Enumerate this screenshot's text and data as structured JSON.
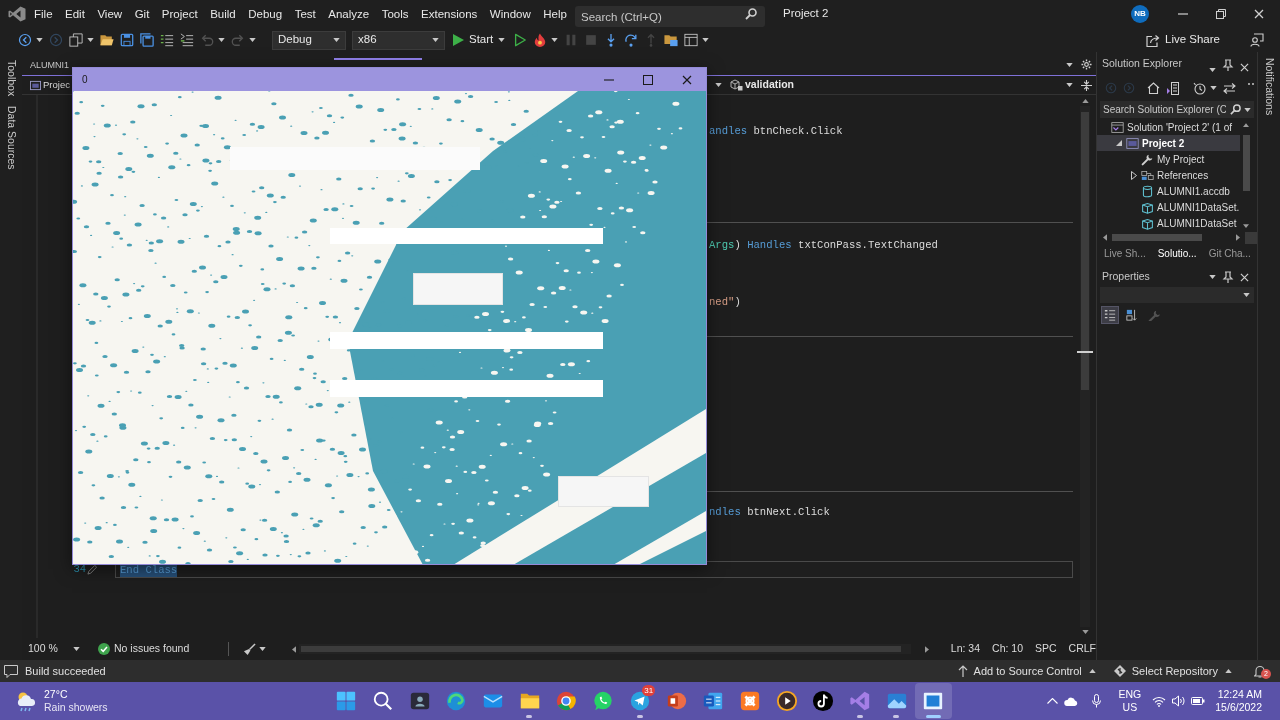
{
  "menu_bar": {
    "items": [
      "File",
      "Edit",
      "View",
      "Git",
      "Project",
      "Build",
      "Debug",
      "Test",
      "Analyze",
      "Tools",
      "Extensions",
      "Window",
      "Help"
    ],
    "search": {
      "placeholder": "Search (Ctrl+Q)"
    },
    "project_name": "Project 2",
    "account_initials": "NB"
  },
  "toolbar": {
    "left_buttons": [
      {
        "kind": "back",
        "disabled": false
      },
      {
        "kind": "forward",
        "disabled": true
      },
      {
        "kind": "new",
        "disabled": false
      },
      {
        "kind": "open",
        "disabled": false
      },
      {
        "kind": "save",
        "disabled": false
      },
      {
        "kind": "saveall",
        "disabled": false
      },
      {
        "kind": "comment",
        "disabled": false
      },
      {
        "kind": "uncomment",
        "disabled": false
      },
      {
        "kind": "undo",
        "disabled": true
      },
      {
        "kind": "redo",
        "disabled": true
      }
    ],
    "configuration": "Debug",
    "platform": "x86",
    "start_label": "Start",
    "right_buttons": [
      {
        "kind": "run",
        "disabled": false
      },
      {
        "kind": "reload",
        "disabled": false
      },
      {
        "kind": "pause",
        "disabled": true
      },
      {
        "kind": "stop",
        "disabled": true
      },
      {
        "kind": "stepinto",
        "disabled": false
      },
      {
        "kind": "stepover",
        "disabled": false
      },
      {
        "kind": "stepout",
        "disabled": true
      },
      {
        "kind": "browse",
        "disabled": false
      },
      {
        "kind": "layout",
        "disabled": false
      }
    ],
    "live_share": "Live Share"
  },
  "side_tabs": [
    "Toolbox",
    "Data Sources"
  ],
  "editor": {
    "tabs": [
      {
        "label": "ALUMNI1",
        "selected": false
      }
    ],
    "navigation": {
      "project": "Projec",
      "member": "validation"
    },
    "code_lines": [
      {
        "selected": false,
        "tokens": [
          {
            "kind": "keyword",
            "text": "andles"
          },
          {
            "kind": "plain",
            "text": " btnCheck.Click"
          }
        ]
      },
      {
        "selected": false,
        "tokens": [
          {
            "kind": "type",
            "text": "Args"
          },
          {
            "kind": "plain",
            "text": ") "
          },
          {
            "kind": "keyword",
            "text": "Handles"
          },
          {
            "kind": "plain",
            "text": " txtConPass.TextChanged"
          }
        ]
      },
      {
        "selected": false,
        "tokens": [
          {
            "kind": "string",
            "text": "ned\""
          },
          {
            "kind": "plain",
            "text": ")"
          }
        ]
      },
      {
        "selected": false,
        "tokens": [
          {
            "kind": "keyword",
            "text": "ndles"
          },
          {
            "kind": "plain",
            "text": " btnNext.Click"
          }
        ]
      },
      {
        "line_number": "34",
        "selected": true,
        "tokens": [
          {
            "kind": "keyword",
            "text": "End Class"
          }
        ]
      }
    ],
    "zoom": "100 %",
    "issues": "No issues found",
    "cursor": {
      "line": "Ln: 34",
      "column": "Ch: 10",
      "indentation": "SPC",
      "line_ending": "CRLF"
    }
  },
  "form_window": {
    "title": "0",
    "controls": [
      {
        "kind": "label"
      },
      {
        "kind": "field"
      },
      {
        "kind": "button"
      },
      {
        "kind": "field"
      },
      {
        "kind": "field"
      },
      {
        "kind": "button"
      }
    ]
  },
  "solution_explorer": {
    "title": "Solution Explorer",
    "search": {
      "placeholder": "Search Solution Explorer (C"
    },
    "tree": [
      {
        "kind": "solution",
        "label": "Solution 'Project 2' (1 of",
        "selected": false,
        "children": [
          {
            "kind": "project",
            "label": "Project 2",
            "selected": true,
            "expanded": true,
            "children": [
              {
                "kind": "settings",
                "label": "My Project",
                "selected": false
              },
              {
                "kind": "references",
                "label": "References",
                "selected": false,
                "expanded": false
              },
              {
                "kind": "database",
                "label": "ALUMNI1.accdb",
                "selected": false
              },
              {
                "kind": "dataset",
                "label": "ALUMNI1DataSet.",
                "selected": false
              },
              {
                "kind": "dataset",
                "label": "ALUMNI1DataSet",
                "selected": false
              }
            ]
          }
        ]
      }
    ],
    "tabs": [
      {
        "label": "Live Sh...",
        "selected": false
      },
      {
        "label": "Solutio...",
        "selected": true
      },
      {
        "label": "Git Cha...",
        "selected": false
      }
    ]
  },
  "properties": {
    "title": "Properties",
    "buttons": [
      {
        "kind": "categorized",
        "selected": true,
        "disabled": false
      },
      {
        "kind": "alphabetical",
        "selected": false,
        "disabled": false
      },
      {
        "kind": "pages",
        "selected": false,
        "disabled": true
      }
    ]
  },
  "notifications_tab": "Notifications",
  "status_bar": {
    "message": "Build succeeded",
    "source_control": "Add to Source Control",
    "repository": "Select Repository",
    "notification_count": "2"
  },
  "taskbar": {
    "weather": {
      "temperature": "27°C",
      "condition": "Rain showers"
    },
    "apps": [
      {
        "kind": "start",
        "running": false,
        "focused": false
      },
      {
        "kind": "search",
        "running": false,
        "focused": false
      },
      {
        "kind": "darkapp",
        "running": false,
        "focused": false
      },
      {
        "kind": "swirl",
        "running": false,
        "focused": false
      },
      {
        "kind": "mail",
        "running": false,
        "focused": false
      },
      {
        "kind": "folder",
        "running": true,
        "focused": false
      },
      {
        "kind": "ring",
        "running": false,
        "focused": false
      },
      {
        "kind": "chat",
        "running": false,
        "focused": false
      },
      {
        "kind": "plane",
        "running": true,
        "focused": false,
        "badge": "31"
      },
      {
        "kind": "slides",
        "running": false,
        "focused": false
      },
      {
        "kind": "document",
        "running": false,
        "focused": false
      },
      {
        "kind": "knot",
        "running": false,
        "focused": false
      },
      {
        "kind": "player",
        "running": false,
        "focused": false
      },
      {
        "kind": "note",
        "running": false,
        "focused": false
      },
      {
        "kind": "infinity",
        "running": true,
        "focused": false
      },
      {
        "kind": "picture",
        "running": true,
        "focused": false
      },
      {
        "kind": "window",
        "running": true,
        "focused": true
      }
    ],
    "tray": {
      "language": "ENG",
      "region": "US",
      "time": "12:24 AM",
      "date": "15/6/2022"
    }
  }
}
